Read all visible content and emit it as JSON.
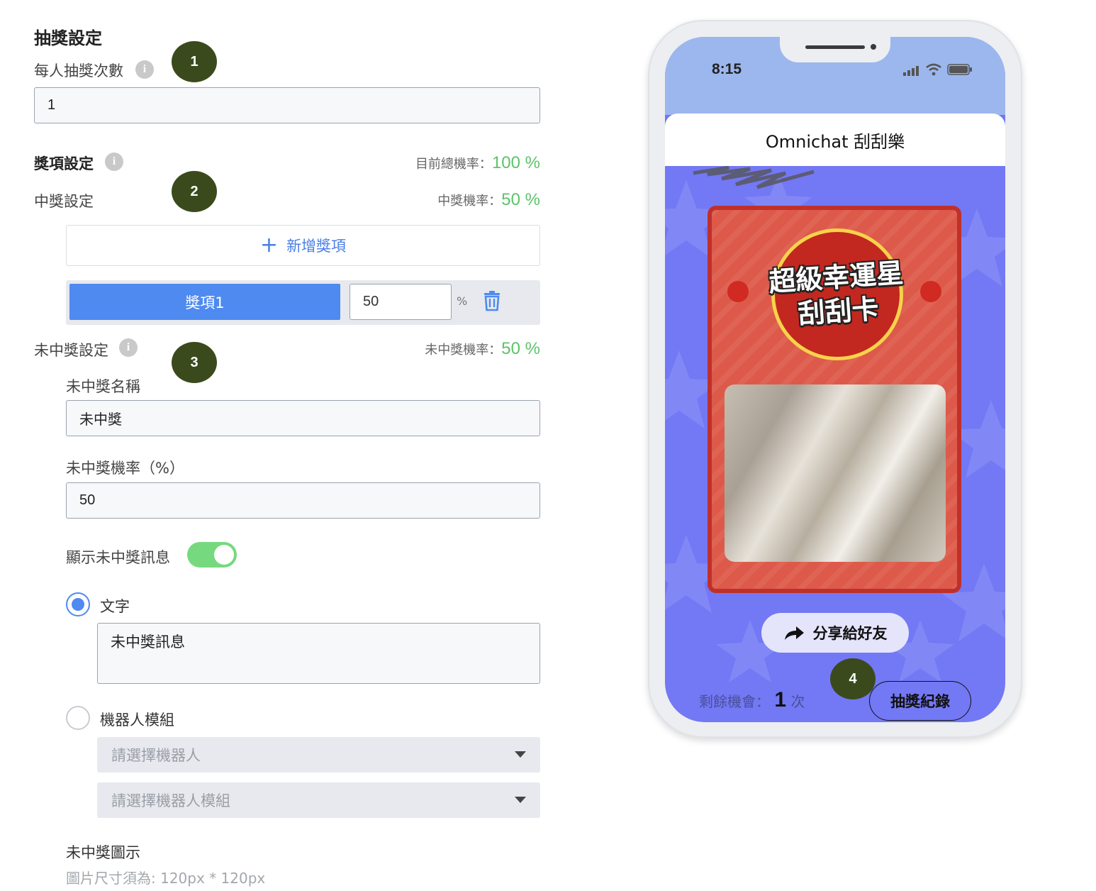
{
  "lottery_settings": {
    "title": "抽獎設定",
    "draws_label": "每人抽獎次數",
    "draws_value": "1"
  },
  "prize_settings": {
    "title": "獎項設定",
    "total_rate_label": "目前總機率：",
    "total_rate_value": "100 %",
    "win_title": "中獎設定",
    "win_rate_label": "中獎機率：",
    "win_rate_value": "50 %",
    "add_label": "新增獎項",
    "prize_name": "獎項1",
    "prize_value": "50",
    "prize_unit": "%"
  },
  "lose_settings": {
    "title": "未中獎設定",
    "rate_label": "未中獎機率：",
    "rate_value": "50 %",
    "name_label": "未中獎名稱",
    "name_value": "未中獎",
    "prob_label": "未中獎機率（%）",
    "prob_value": "50",
    "show_msg_label": "顯示未中獎訊息",
    "show_msg_on": true,
    "option_text_label": "文字",
    "text_value": "未中獎訊息",
    "option_bot_label": "機器人模組",
    "bot_placeholder": "請選擇機器人",
    "module_placeholder": "請選擇機器人模組",
    "icon_label": "未中獎圖示",
    "icon_hint": "圖片尺寸須為: 120px * 120px"
  },
  "badges": [
    "1",
    "2",
    "3",
    "4"
  ],
  "phone": {
    "time": "8:15",
    "app_title": "Omnichat 刮刮樂",
    "card_title_line1": "超級幸運星",
    "card_title_line2": "刮刮卡",
    "share_label": "分享給好友",
    "remaining_label": "剩餘機會：",
    "remaining_count": "1",
    "remaining_unit": "次",
    "record_label": "抽獎紀錄"
  },
  "colors": {
    "accent_blue": "#4e8af0",
    "rate_green": "#5cc36a",
    "badge": "#3b4a1c",
    "phone_bg": "#7378f4",
    "card_red": "#dd5a4a"
  }
}
